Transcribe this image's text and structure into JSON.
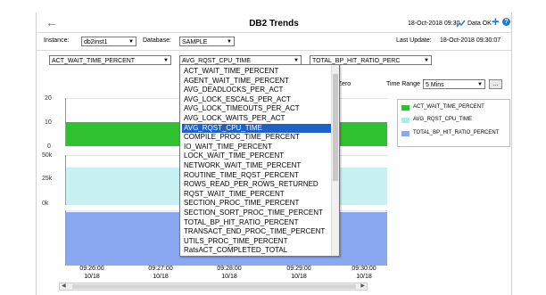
{
  "header": {
    "title": "DB2 Trends",
    "date": "18-Oct-2018 09:30",
    "data_status": "Data OK"
  },
  "filters": {
    "instance_label": "Instance:",
    "instance_value": "db2inst1",
    "database_label": "Database:",
    "database_value": "SAMPLE",
    "last_update_label": "Last Update:",
    "last_update_value": "18-Oct-2018 09:30:07"
  },
  "metric_selectors": {
    "metric1": "ACT_WAIT_TIME_PERCENT",
    "metric2": "AVG_RQST_CPU_TIME",
    "metric3": "TOTAL_BP_HIT_RATIO_PERC"
  },
  "controls": {
    "partial_label": "at Zero",
    "time_range_label": "Time Range",
    "time_range_value": "5 Mins",
    "more_button": "..."
  },
  "dropdown": {
    "items": [
      "ACT_WAIT_TIME_PERCENT",
      "AGENT_WAIT_TIME_PERCENT",
      "AVG_DEADLOCKS_PER_ACT",
      "AVG_LOCK_ESCALS_PER_ACT",
      "AVG_LOCK_TIMEOUTS_PER_ACT",
      "AVG_LOCK_WAITS_PER_ACT",
      "AVG_RQST_CPU_TIME",
      "COMPILE_PROC_TIME_PERCENT",
      "IO_WAIT_TIME_PERCENT",
      "LOCK_WAIT_TIME_PERCENT",
      "NETWORK_WAIT_TIME_PERCENT",
      "ROUTINE_TIME_RQST_PERCENT",
      "ROWS_READ_PER_ROWS_RETURNED",
      "RQST_WAIT_TIME_PERCENT",
      "SECTION_PROC_TIME_PERCENT",
      "SECTION_SORT_PROC_TIME_PERCENT",
      "TOTAL_BP_HIT_RATIO_PERCENT",
      "TRANSACT_END_PROC_TIME_PERCENT",
      "UTILS_PROC_TIME_PERCENT",
      "RatsACT_COMPLETED_TOTAL"
    ],
    "selected": "AVG_RQST_CPU_TIME"
  },
  "chart": {
    "y_ticks_top": [
      "20",
      "10",
      "0"
    ],
    "y_ticks_mid": [
      "50k",
      "25k",
      "0k"
    ],
    "x_labels": [
      {
        "time": "09:26:00",
        "date": "10/18"
      },
      {
        "time": "09:27:00",
        "date": "10/18"
      },
      {
        "time": "09:28:00",
        "date": "10/18"
      },
      {
        "time": "09:29:00",
        "date": "10/18"
      },
      {
        "time": "09:30:00",
        "date": "10/18"
      }
    ],
    "legend": [
      {
        "name": "ACT_WAIT_TIME_PERCENT",
        "color": "#2fc12f"
      },
      {
        "name": "AVG_RQST_CPU_TIME",
        "color": "#a8ecec"
      },
      {
        "name": "TOTAL_BP_HIT_RATIO_PERCENT",
        "color": "#8aa8f2"
      }
    ]
  },
  "colors": {
    "accent": "#1e7bd4",
    "series_green": "#2fc12f",
    "series_cyan": "#c8f1f1",
    "series_blue": "#8aa8f2"
  }
}
